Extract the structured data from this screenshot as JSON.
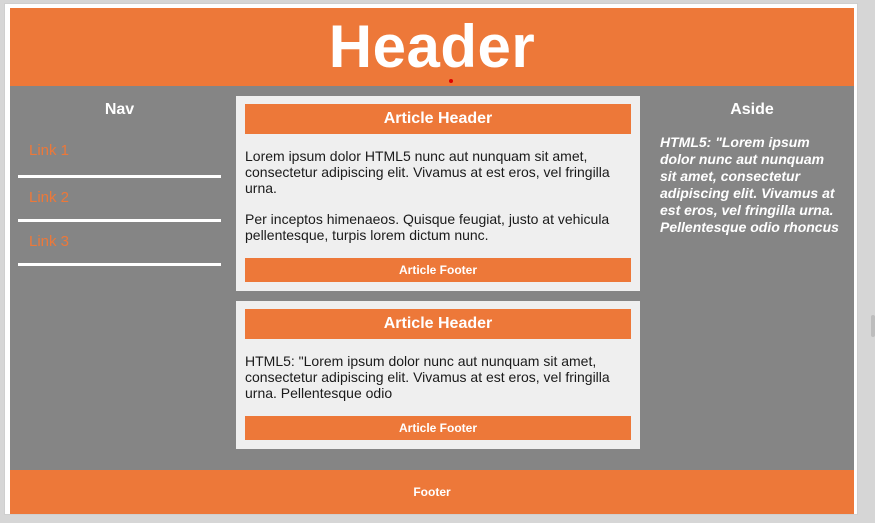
{
  "header": {
    "title": "Header"
  },
  "nav": {
    "title": "Nav",
    "links": [
      "Link 1",
      "Link 2",
      "Link 3"
    ]
  },
  "articles": [
    {
      "header": "Article Header",
      "paragraphs": [
        "Lorem ipsum dolor HTML5 nunc aut nunquam sit amet, consectetur adipiscing elit. Vivamus at est eros, vel fringilla urna.",
        "Per inceptos himenaeos. Quisque feugiat, justo at vehicula pellentesque, turpis lorem dictum nunc."
      ],
      "footer": "Article Footer"
    },
    {
      "header": "Article Header",
      "paragraphs": [
        "HTML5: \"Lorem ipsum dolor nunc aut nunquam sit amet, consectetur adipiscing elit. Vivamus at est eros, vel fringilla urna. Pellentesque odio"
      ],
      "footer": "Article Footer"
    }
  ],
  "aside": {
    "title": "Aside",
    "text": "HTML5: \"Lorem ipsum dolor nunc aut nunquam sit amet, consectetur adipiscing elit. Vivamus at est eros, vel fringilla urna. Pellentesque odio rhoncus"
  },
  "footer": {
    "text": "Footer"
  },
  "colors": {
    "accent": "#ed7839",
    "panel": "#858585",
    "article_bg": "#efefef"
  }
}
